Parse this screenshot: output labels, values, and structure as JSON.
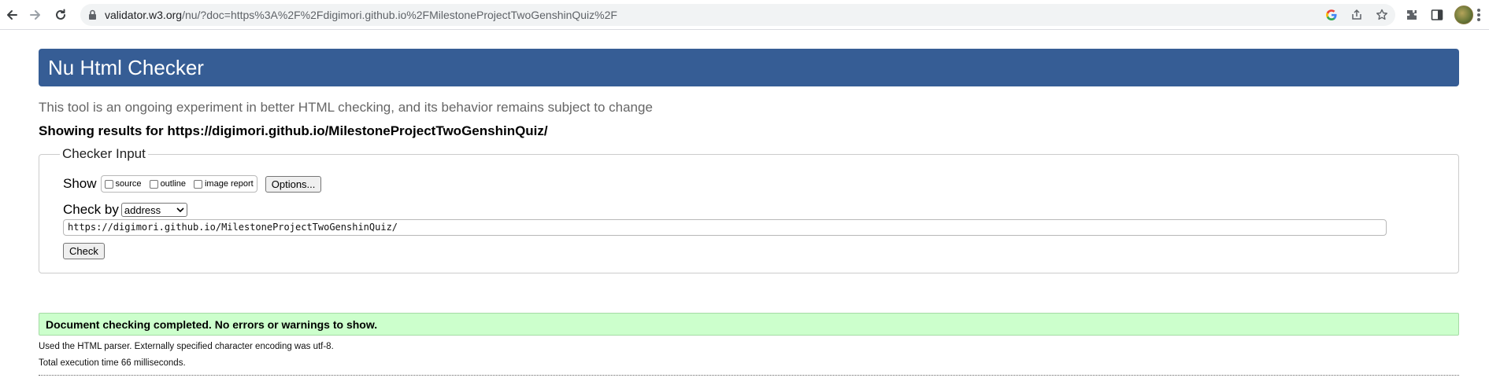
{
  "browser": {
    "url_host": "validator.w3.org",
    "url_rest": "/nu/?doc=https%3A%2F%2Fdigimori.github.io%2FMilestoneProjectTwoGenshinQuiz%2F",
    "icons": [
      "back-icon",
      "forward-icon",
      "reload-icon",
      "lock-icon",
      "google-icon",
      "share-icon",
      "star-icon",
      "extensions-icon",
      "side-panel-icon",
      "profile-avatar",
      "menu-icon"
    ]
  },
  "page": {
    "title": "Nu Html Checker",
    "intro": "This tool is an ongoing experiment in better HTML checking, and its behavior remains subject to change",
    "showing_results": "Showing results for https://digimori.github.io/MilestoneProjectTwoGenshinQuiz/",
    "banner_color": "#365d95"
  },
  "checker_input": {
    "legend": "Checker Input",
    "show_label": "Show",
    "show_options": [
      "source",
      "outline",
      "image report"
    ],
    "options_button": "Options...",
    "check_by_label": "Check by",
    "check_by_value": "address",
    "address_value": "https://digimori.github.io/MilestoneProjectTwoGenshinQuiz/",
    "check_button": "Check"
  },
  "results": {
    "success_message": "Document checking completed. No errors or warnings to show.",
    "success_color": "#ccffcc",
    "parser_info": "Used the HTML parser. Externally specified character encoding was utf-8.",
    "execution_time": "Total execution time 66 milliseconds."
  }
}
